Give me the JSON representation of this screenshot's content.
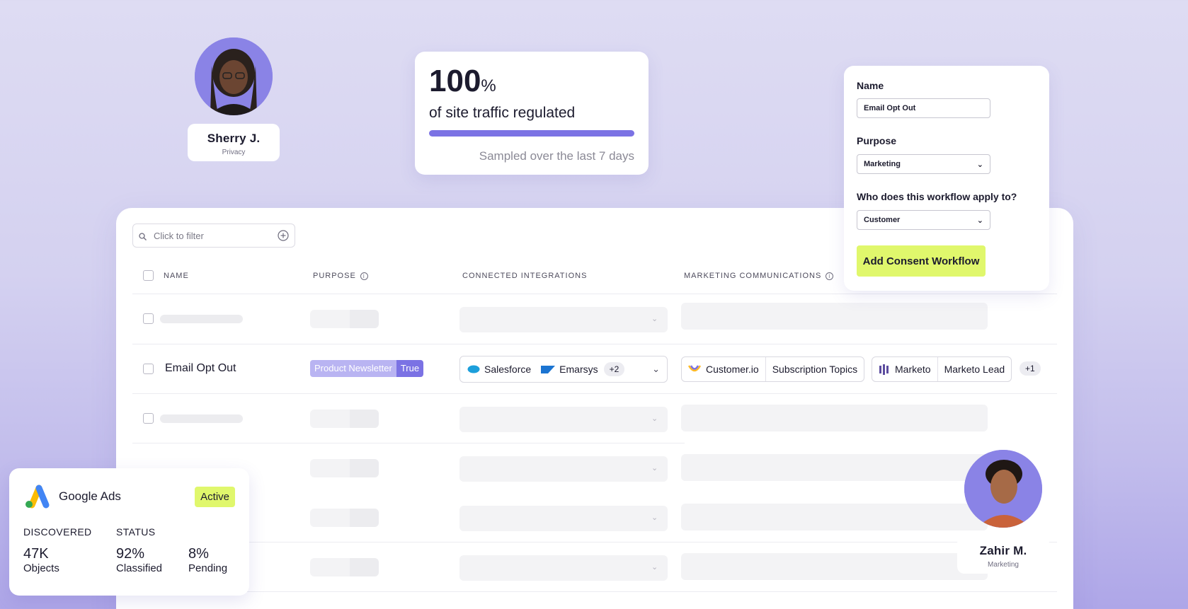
{
  "profiles": {
    "left": {
      "name": "Sherry J.",
      "role": "Privacy"
    },
    "right": {
      "name": "Zahir M.",
      "role": "Marketing"
    }
  },
  "traffic": {
    "value": "100",
    "unit": "%",
    "label": "of site traffic regulated",
    "progress": 1.0,
    "note": "Sampled over the last 7 days"
  },
  "workflow_form": {
    "name_label": "Name",
    "name_value": "Email Opt Out",
    "purpose_label": "Purpose",
    "purpose_value": "Marketing",
    "applies_label": "Who does this workflow apply to?",
    "applies_value": "Customer",
    "submit_label": "Add Consent Workflow"
  },
  "table": {
    "filter_placeholder": "Click to filter",
    "columns": {
      "name": "NAME",
      "purpose": "PURPOSE",
      "integrations": "CONNECTED INTEGRATIONS",
      "marketing": "MARKETING COMMUNICATIONS"
    },
    "row": {
      "name": "Email Opt Out",
      "purpose_tag": "Product Newsletter",
      "purpose_value": "True",
      "integrations": [
        "Salesforce",
        "Emarsys"
      ],
      "integrations_more": "+2",
      "marketing_groups": [
        [
          "Customer.io",
          "Subscription Topics"
        ],
        [
          "Marketo",
          "Marketo Lead"
        ]
      ],
      "marketing_more": "+1"
    }
  },
  "google_ads": {
    "title": "Google Ads",
    "status_badge": "Active",
    "discovered_label": "DISCOVERED",
    "status_label": "STATUS",
    "objects_value": "47K",
    "objects_label": "Objects",
    "classified_value": "92%",
    "classified_label": "Classified",
    "pending_value": "8%",
    "pending_label": "Pending"
  },
  "colors": {
    "accent": "#7b72e4",
    "accent_light": "#b9b4f2",
    "highlight": "#e0f76c"
  }
}
